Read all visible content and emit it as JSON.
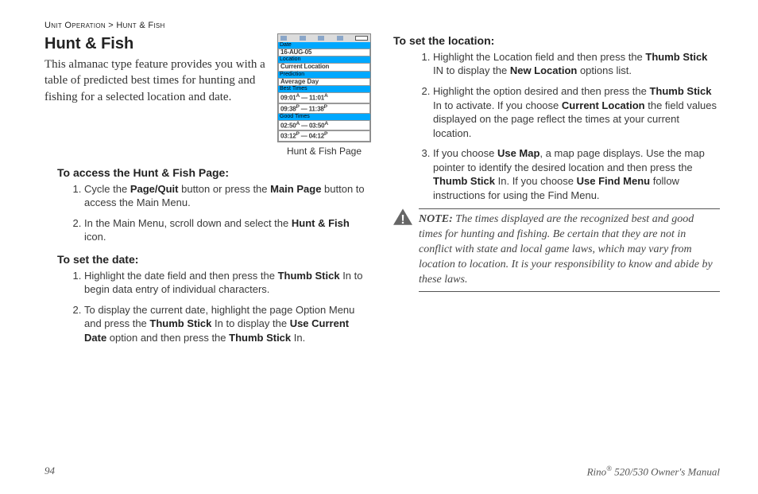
{
  "breadcrumb": {
    "a": "Unit Operation",
    "sep": " > ",
    "b": "Hunt & Fish"
  },
  "title": "Hunt & Fish",
  "intro": "This almanac type feature provides you with a table of predicted best times for hunting and fishing for a selected location and date.",
  "figure_caption": "Hunt & Fish Page",
  "device": {
    "date_label": "Date",
    "date_value": "16-AUG-05",
    "loc_label": "Location",
    "loc_value": "Current Location",
    "pred_label": "Prediction",
    "pred_value": "Average Day",
    "best_label": "Best Times",
    "best1a": "09:01",
    "best1_sup": "A",
    "best1b": "11:01",
    "best1b_sup": "A",
    "best2a": "09:38",
    "best2_sup": "P",
    "best2b": "11:38",
    "best2b_sup": "P",
    "good_label": "Good Times",
    "good1a": "02:50",
    "good1_sup": "A",
    "good1b": "03:50",
    "good1b_sup": "A",
    "good2a": "03:12",
    "good2_sup": "P",
    "good2b": "04:12",
    "good2b_sup": "P"
  },
  "sections": {
    "access_head": "To access the Hunt & Fish Page:",
    "access_steps": [
      {
        "pre": "Cycle the ",
        "b1": "Page/Quit",
        "mid": " button or press the ",
        "b2": "Main Page",
        "post": " button to access the Main Menu."
      },
      {
        "pre": "In the Main Menu, scroll down and select the ",
        "b1": "Hunt & Fish",
        "post": " icon."
      }
    ],
    "date_head": "To set the date:",
    "date_steps": [
      {
        "pre": "Highlight the date field and then press the ",
        "b1": "Thumb Stick",
        "post": " In to begin data entry of individual characters."
      },
      {
        "pre": "To display the current date, highlight the page Option Menu and press the ",
        "b1": "Thumb Stick",
        "mid": " In to display the ",
        "b2": "Use Current Date",
        "mid2": " option and then press the ",
        "b3": "Thumb Stick",
        "post": " In."
      }
    ],
    "loc_head": "To set the location:",
    "loc_steps": [
      {
        "pre": "Highlight the Location field and then press the ",
        "b1": "Thumb Stick",
        "mid": " IN to display the ",
        "b2": "New Location",
        "post": " options list."
      },
      {
        "pre": "Highlight the option desired and then press the ",
        "b1": "Thumb Stick",
        "mid": " In to activate. If you choose ",
        "b2": "Current Location",
        "post": " the field values displayed on the page reflect the times at your current location."
      },
      {
        "pre": "If you choose ",
        "b1": "Use Map",
        "mid": ", a map page displays. Use the map pointer to identify the desired location and then press the ",
        "b2": "Thumb Stick",
        "mid2": " In. If you choose ",
        "b3": "Use Find Menu",
        "post": " follow instructions for using the Find Menu."
      }
    ]
  },
  "note_label": "NOTE:",
  "note_body": " The times displayed are the recognized best and good times for hunting and fishing. Be certain that they are not in conflict with state and local game laws, which may vary from location to location. It is your responsibility to know and abide by these laws.",
  "footer": {
    "page": "94",
    "doc_a": "Rino",
    "doc_sup": "®",
    "doc_b": " 520/530 Owner's Manual"
  }
}
